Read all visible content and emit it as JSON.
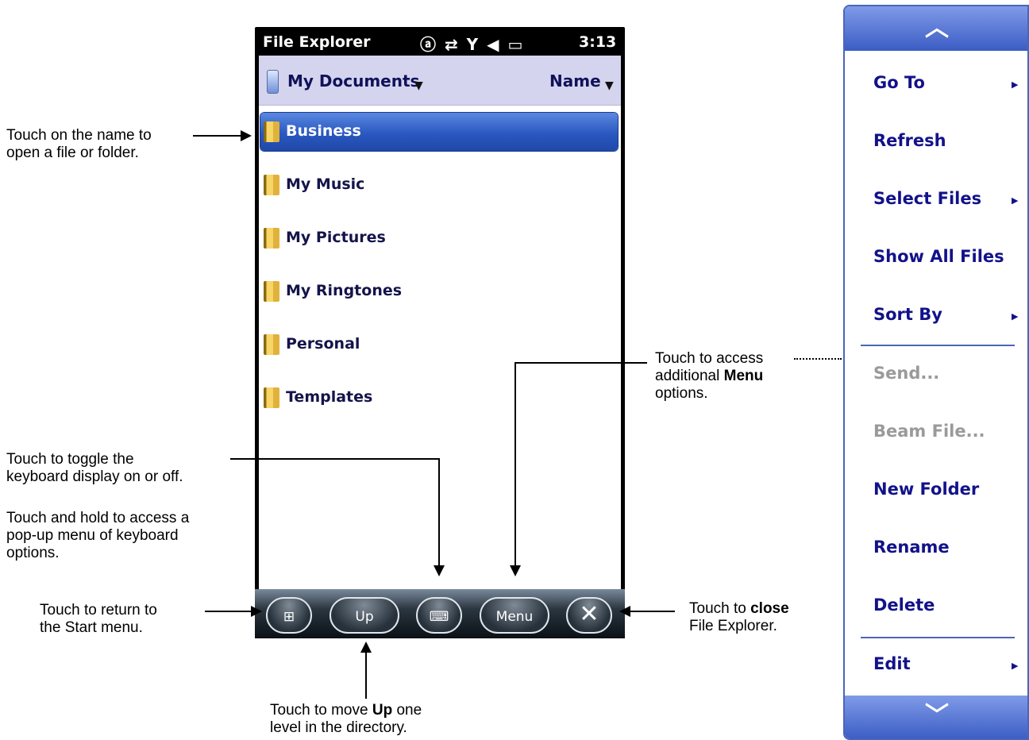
{
  "status_bar": {
    "app_title": "File Explorer",
    "icons": [
      "input-mode-icon",
      "data-sync-icon",
      "signal-icon",
      "speaker-icon",
      "battery-icon"
    ],
    "status_glyphs": "ⓐ ⇄ Y ◀ ▭",
    "time": "3:13"
  },
  "folder_bar": {
    "folder": "My Documents",
    "sort": "Name"
  },
  "files": [
    "Business",
    "My Music",
    "My Pictures",
    "My Ringtones",
    "Personal",
    "Templates"
  ],
  "selected_file": "Business",
  "taskbar": {
    "up_label": "Up",
    "menu_label": "Menu",
    "close_glyph": "✕",
    "start_glyph": "⊞",
    "keyboard_glyph": "⌨"
  },
  "menu": {
    "items": [
      {
        "label": "Go To",
        "submenu": true,
        "enabled": true
      },
      {
        "label": "Refresh",
        "submenu": false,
        "enabled": true
      },
      {
        "label": "Select Files",
        "submenu": true,
        "enabled": true
      },
      {
        "label": "Show All Files",
        "submenu": false,
        "enabled": true
      },
      {
        "label": "Sort By",
        "submenu": true,
        "enabled": true
      },
      {
        "label": "Send...",
        "submenu": false,
        "enabled": false
      },
      {
        "label": "Beam File...",
        "submenu": false,
        "enabled": false
      },
      {
        "label": "New Folder",
        "submenu": false,
        "enabled": true
      },
      {
        "label": "Rename",
        "submenu": false,
        "enabled": true
      },
      {
        "label": "Delete",
        "submenu": false,
        "enabled": true
      },
      {
        "label": "Edit",
        "submenu": true,
        "enabled": true
      }
    ],
    "scroll_up_glyph": "︿",
    "scroll_down_glyph": "﹀",
    "submenu_glyph": "▶"
  },
  "callouts": {
    "open": "Touch on the name to\nopen a file or folder.",
    "keyboard_toggle": "Touch to toggle the\nkeyboard display on or off.",
    "keyboard_hold": "Touch and hold to access a\npop-up menu of keyboard\noptions.",
    "start": "Touch to return to\nthe Start menu.",
    "menu_pre": "Touch to access\nadditional ",
    "menu_bold": "Menu",
    "menu_post": "\noptions.",
    "close_pre": "Touch to ",
    "close_bold": "close",
    "close_post": "\nFile Explorer.",
    "up_pre": "Touch to move ",
    "up_bold": "Up",
    "up_post": " one\nlevel in the directory."
  },
  "colors": {
    "accent": "#2a58c0",
    "menu_text": "#12128a",
    "disabled": "#9a9a9a",
    "folder_bar": "#d4d4ee"
  }
}
